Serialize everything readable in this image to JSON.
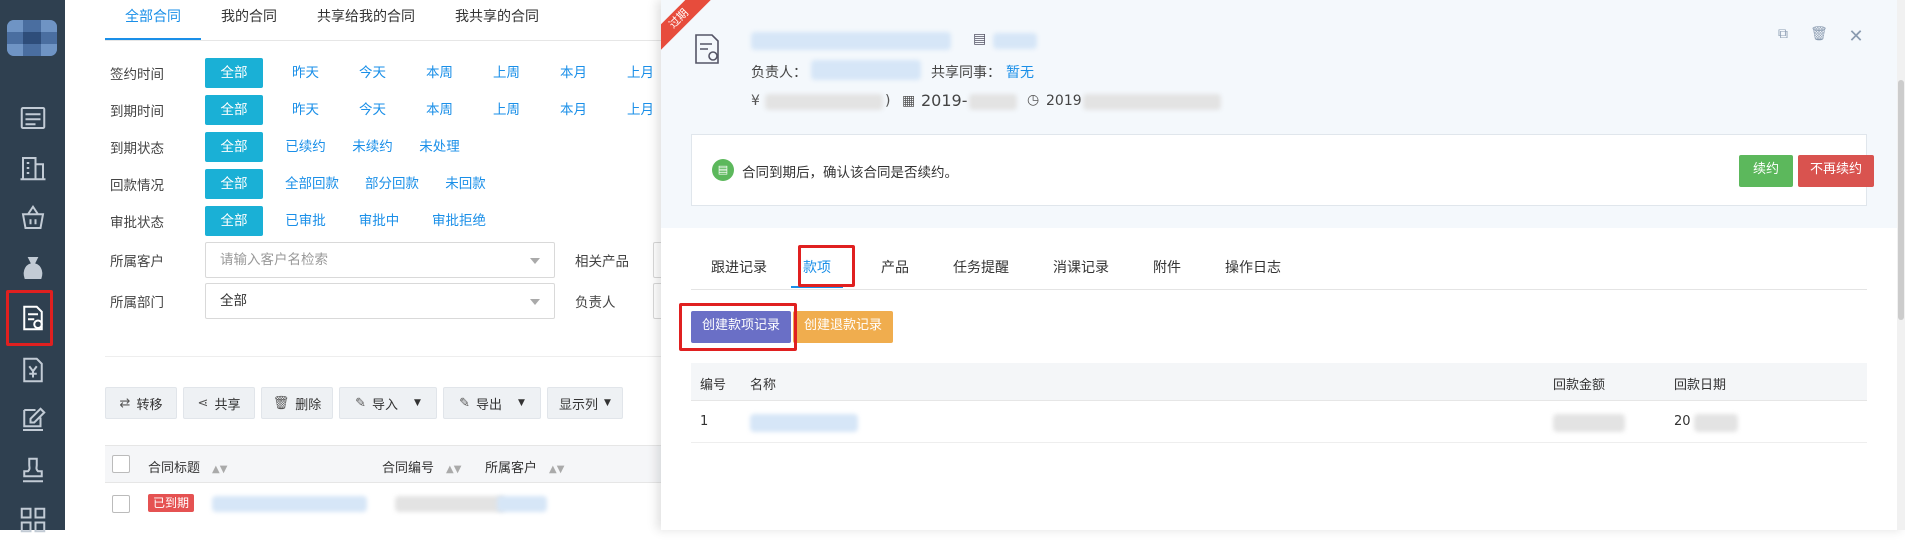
{
  "sidebar": {
    "items": [
      {
        "icon": "list-icon"
      },
      {
        "icon": "building-icon"
      },
      {
        "icon": "basket-icon"
      },
      {
        "icon": "money-bag-icon"
      },
      {
        "icon": "contract-icon",
        "active": true
      },
      {
        "icon": "finance-icon"
      },
      {
        "icon": "edit-icon"
      },
      {
        "icon": "stamp-icon"
      },
      {
        "icon": "apps-icon"
      }
    ]
  },
  "main": {
    "tabs": [
      "全部合同",
      "我的合同",
      "共享给我的合同",
      "我共享的合同"
    ],
    "active_tab": "全部合同",
    "filters": [
      {
        "label": "签约时间",
        "options": [
          "全部",
          "昨天",
          "今天",
          "本周",
          "上周",
          "本月",
          "上月"
        ]
      },
      {
        "label": "到期时间",
        "options": [
          "全部",
          "昨天",
          "今天",
          "本周",
          "上周",
          "本月",
          "上月"
        ]
      },
      {
        "label": "到期状态",
        "options": [
          "全部",
          "已续约",
          "未续约",
          "未处理"
        ]
      },
      {
        "label": "回款情况",
        "options": [
          "全部",
          "全部回款",
          "部分回款",
          "未回款"
        ]
      },
      {
        "label": "审批状态",
        "options": [
          "全部",
          "已审批",
          "审批中",
          "审批拒绝"
        ]
      }
    ],
    "customer_label": "所属客户",
    "customer_placeholder": "请输入客户名检索",
    "product_label": "相关产品",
    "department_label": "所属部门",
    "department_value": "全部",
    "owner_label": "负责人",
    "toolbar": {
      "transfer": "转移",
      "share": "共享",
      "delete": "删除",
      "import": "导入",
      "export": "导出",
      "display": "显示列"
    },
    "table": {
      "headers": [
        "合同标题",
        "合同编号",
        "所属客户"
      ],
      "row_badge": "已到期"
    }
  },
  "panel": {
    "ribbon": "过期",
    "owner_label": "负责人：",
    "colleague_label": "共享同事：",
    "colleague_value": "暂无",
    "amount_prefix": "¥",
    "amount_suffix": ")",
    "start_date_prefix": "2019-",
    "end_date_prefix": "2019",
    "alert_text": "合同到期后，确认该合同是否续约。",
    "renew_button": "续约",
    "no_renew_button": "不再续约",
    "tabs": [
      "跟进记录",
      "款项",
      "产品",
      "任务提醒",
      "消课记录",
      "附件",
      "操作日志"
    ],
    "active_tab": "款项",
    "create_payment_button": "创建款项记录",
    "create_refund_button": "创建退款记录",
    "table": {
      "headers": [
        "编号",
        "名称",
        "回款金额",
        "回款日期"
      ],
      "rows": [
        {
          "no": "1",
          "date_prefix": "20"
        }
      ]
    },
    "colors": {
      "renew": "#5cb85c",
      "no_renew": "#d9534f",
      "primary_action": "#6a6fc6",
      "refund": "#f0ad4e"
    }
  }
}
